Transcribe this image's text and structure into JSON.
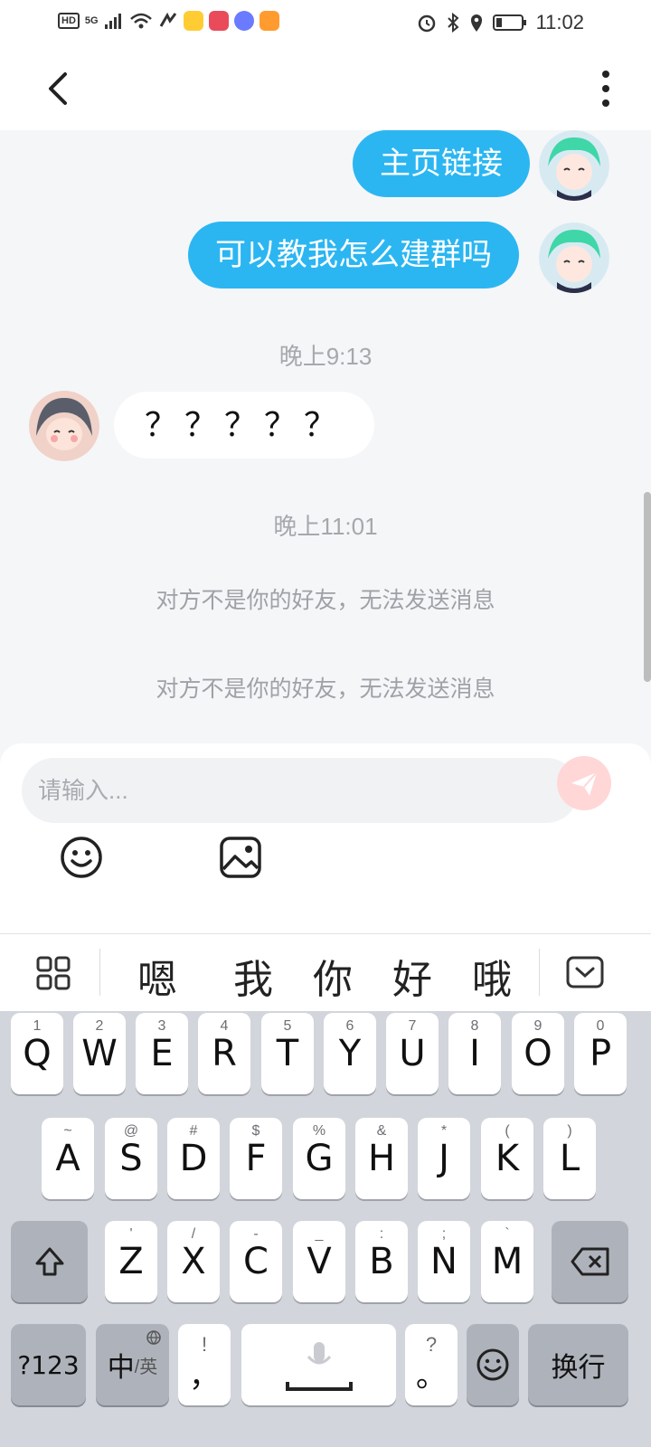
{
  "status_bar": {
    "left_badges": [
      "HD",
      "5G"
    ],
    "time": "11:02"
  },
  "chat": {
    "outgoing": [
      {
        "text": "主页链接"
      },
      {
        "text": "可以教我怎么建群吗"
      }
    ],
    "time_1": "晚上9:13",
    "incoming": [
      {
        "text": "？？？？？"
      }
    ],
    "time_2": "晚上11:01",
    "system_msgs": [
      "对方不是你的好友，无法发送消息",
      "对方不是你的好友，无法发送消息"
    ]
  },
  "composer": {
    "placeholder": "请输入..."
  },
  "candidates": [
    "嗯",
    "我",
    "你",
    "好",
    "哦"
  ],
  "keyboard": {
    "row1": [
      {
        "k": "Q",
        "n": "1"
      },
      {
        "k": "W",
        "n": "2"
      },
      {
        "k": "E",
        "n": "3"
      },
      {
        "k": "R",
        "n": "4"
      },
      {
        "k": "T",
        "n": "5"
      },
      {
        "k": "Y",
        "n": "6"
      },
      {
        "k": "U",
        "n": "7"
      },
      {
        "k": "I",
        "n": "8"
      },
      {
        "k": "O",
        "n": "9"
      },
      {
        "k": "P",
        "n": "0"
      }
    ],
    "row2": [
      {
        "k": "A",
        "n": "~"
      },
      {
        "k": "S",
        "n": "@"
      },
      {
        "k": "D",
        "n": "#"
      },
      {
        "k": "F",
        "n": "$"
      },
      {
        "k": "G",
        "n": "%"
      },
      {
        "k": "H",
        "n": "&"
      },
      {
        "k": "J",
        "n": "*"
      },
      {
        "k": "K",
        "n": "("
      },
      {
        "k": "L",
        "n": ")"
      }
    ],
    "row3": [
      {
        "k": "Z",
        "n": "'"
      },
      {
        "k": "X",
        "n": "/"
      },
      {
        "k": "C",
        "n": "-"
      },
      {
        "k": "V",
        "n": "_"
      },
      {
        "k": "B",
        "n": ":"
      },
      {
        "k": "N",
        "n": ";"
      },
      {
        "k": "M",
        "n": "`"
      }
    ],
    "num_key": "?123",
    "lang_key": "中",
    "lang_key_sub": "/英",
    "comma_key": "，",
    "comma_sub": "!",
    "period_key": "。",
    "period_sub": "?",
    "enter_key": "换行"
  },
  "colors": {
    "bubble": "#2bb6f2",
    "send": "#ff8f8f"
  }
}
